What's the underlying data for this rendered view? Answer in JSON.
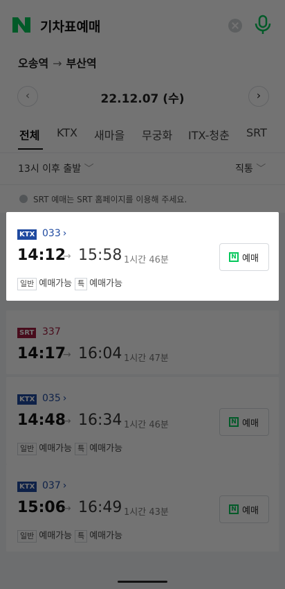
{
  "header": {
    "search_query": "기차표예매"
  },
  "route": {
    "from": "오송역",
    "arrow": "→",
    "to": "부산역"
  },
  "date": {
    "prev": "‹",
    "label": "22.12.07 (수)",
    "next": "›"
  },
  "tabs": [
    "전체",
    "KTX",
    "새마을",
    "무궁화",
    "ITX-청춘",
    "SRT"
  ],
  "filters": {
    "time_filter": "13시 이후 출발",
    "direct_filter": "직통"
  },
  "notice": "SRT 예매는 SRT 홈페이지를 이용해 주세요.",
  "trains": [
    {
      "type": "KTX",
      "number": "033",
      "depart": "14:12",
      "arrive": "15:58",
      "duration": "1시간 46분",
      "seat1": "일반",
      "seat1_status": "예매가능",
      "seat2": "특",
      "seat2_status": "예매가능",
      "book_label": "예매"
    },
    {
      "type": "SRT",
      "number": "337",
      "depart": "14:17",
      "arrive": "16:04",
      "duration": "1시간 47분"
    },
    {
      "type": "KTX",
      "number": "035",
      "depart": "14:48",
      "arrive": "16:34",
      "duration": "1시간 46분",
      "seat1": "일반",
      "seat1_status": "예매가능",
      "seat2": "특",
      "seat2_status": "예매가능",
      "book_label": "예매"
    },
    {
      "type": "KTX",
      "number": "037",
      "depart": "15:06",
      "arrive": "16:49",
      "duration": "1시간 43분",
      "seat1": "일반",
      "seat1_status": "예매가능",
      "seat2": "특",
      "seat2_status": "예매가능",
      "book_label": "예매"
    }
  ],
  "colors": {
    "naver_green": "#03c75a",
    "ktx_blue": "#1f4aa0",
    "srt_red": "#a01c3e"
  }
}
